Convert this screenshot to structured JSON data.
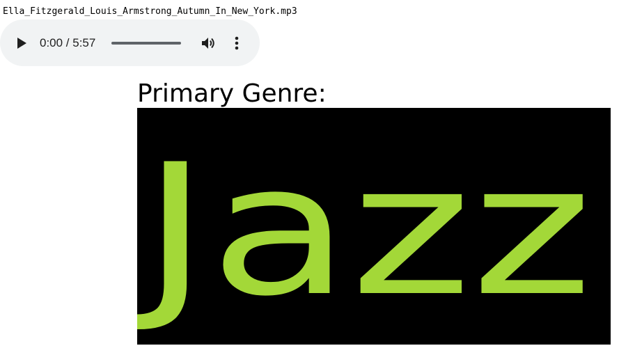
{
  "file": {
    "name": "Ella_Fitzgerald_Louis_Armstrong_Autumn_In_New_York.mp3"
  },
  "player": {
    "time_display": "0:00 / 5:57",
    "progress": 0,
    "play_icon": "play-icon",
    "volume_icon": "volume-icon",
    "menu_icon": "more-vertical-icon"
  },
  "genre": {
    "heading": "Primary Genre:",
    "value": "Jazz",
    "text_color": "#a3d838",
    "background_color": "#000000"
  }
}
